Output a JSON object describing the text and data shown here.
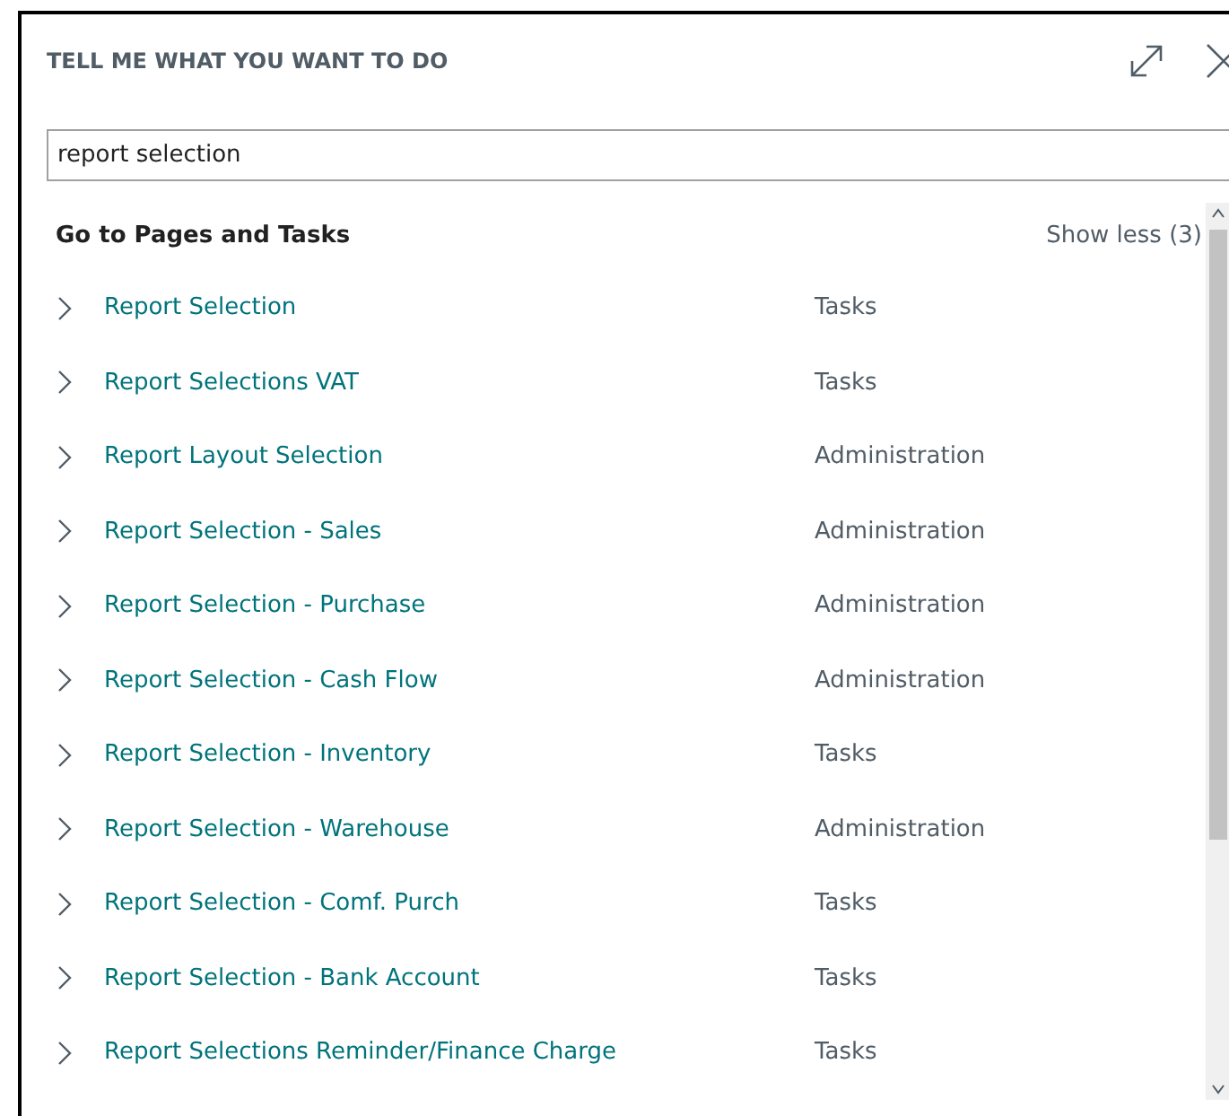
{
  "dialog": {
    "title": "TELL ME WHAT YOU WANT TO DO"
  },
  "search": {
    "value": "report selection"
  },
  "section": {
    "title": "Go to Pages and Tasks",
    "toggle": "Show less (3)"
  },
  "results": [
    {
      "name": "Report Selection",
      "category": "Tasks"
    },
    {
      "name": "Report Selections VAT",
      "category": "Tasks"
    },
    {
      "name": "Report Layout Selection",
      "category": "Administration"
    },
    {
      "name": "Report Selection - Sales",
      "category": "Administration"
    },
    {
      "name": "Report Selection - Purchase",
      "category": "Administration"
    },
    {
      "name": "Report Selection - Cash Flow",
      "category": "Administration"
    },
    {
      "name": "Report Selection - Inventory",
      "category": "Tasks"
    },
    {
      "name": "Report Selection - Warehouse",
      "category": "Administration"
    },
    {
      "name": "Report Selection - Comf. Purch",
      "category": "Tasks"
    },
    {
      "name": "Report Selection - Bank Account",
      "category": "Tasks"
    },
    {
      "name": "Report Selections Reminder/Finance Charge",
      "category": "Tasks"
    }
  ]
}
